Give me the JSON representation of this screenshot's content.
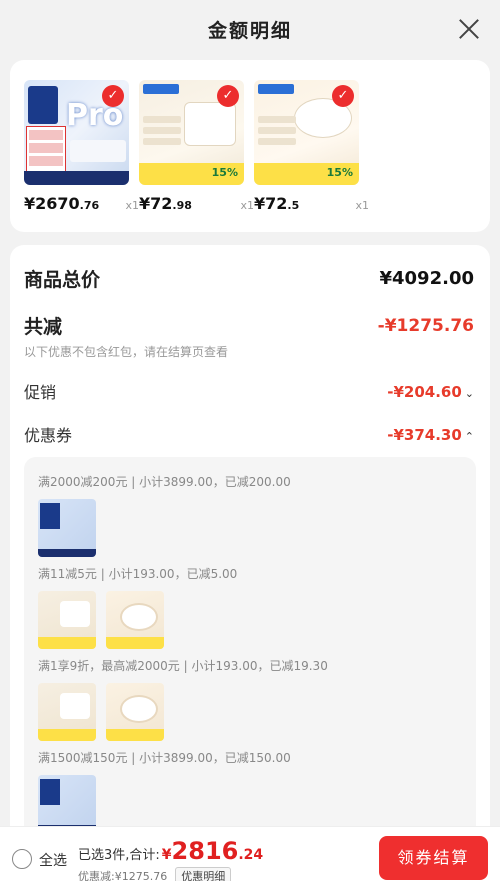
{
  "header": {
    "title": "金额明细"
  },
  "products": [
    {
      "price_int": "¥2670",
      "price_dec": ".76",
      "qty": "x1",
      "img_text": "Pro"
    },
    {
      "price_int": "¥72",
      "price_dec": ".98",
      "qty": "x1"
    },
    {
      "price_int": "¥72",
      "price_dec": ".5",
      "qty": "x1"
    }
  ],
  "details": {
    "total_label": "商品总价",
    "total_value": "¥4092.00",
    "reduce_label": "共减",
    "reduce_value": "-¥1275.76",
    "reduce_note": "以下优惠不包含红包，请在结算页查看",
    "promo_label": "促销",
    "promo_value": "-¥204.60",
    "coupon_label": "优惠券",
    "coupon_value": "-¥374.30"
  },
  "coupons": [
    {
      "text": "满2000减200元 | 小计3899.00，已减200.00"
    },
    {
      "text": "满11减5元 | 小计193.00，已减5.00"
    },
    {
      "text": "满1享9折，最高减2000元 | 小计193.00，已减19.30"
    },
    {
      "text": "满1500减150元 | 小计3899.00，已减150.00"
    }
  ],
  "bottom": {
    "select_all": "全选",
    "summary_text": "已选3件,合计:",
    "yen": "¥",
    "total_int": "2816",
    "total_dec": ".24",
    "discount_text": "优惠减:¥1275.76",
    "detail_tag": "优惠明细",
    "checkout": "领券结算"
  }
}
